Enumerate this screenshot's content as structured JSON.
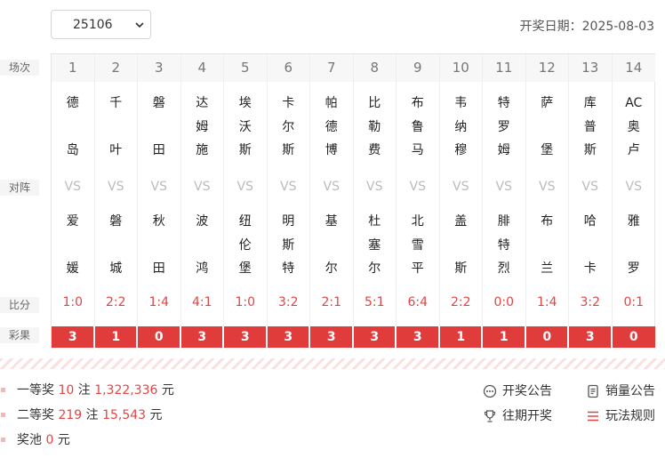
{
  "issue_select": {
    "value": "25106"
  },
  "draw_date_label": "开奖日期：2025-08-03",
  "row_labels": {
    "match": "场次",
    "versus": "对阵",
    "score": "比分",
    "result": "彩果"
  },
  "vs_text": "VS",
  "matches": [
    {
      "no": "1",
      "home": [
        "德",
        "岛"
      ],
      "away": [
        "爱",
        "媛"
      ],
      "score": "1:0",
      "result": "3"
    },
    {
      "no": "2",
      "home": [
        "千",
        "叶"
      ],
      "away": [
        "磐",
        "城"
      ],
      "score": "2:2",
      "result": "1"
    },
    {
      "no": "3",
      "home": [
        "磐",
        "田"
      ],
      "away": [
        "秋",
        "田"
      ],
      "score": "1:4",
      "result": "0"
    },
    {
      "no": "4",
      "home": [
        "达",
        "姆",
        "施"
      ],
      "away": [
        "波",
        "鸿"
      ],
      "score": "4:1",
      "result": "3"
    },
    {
      "no": "5",
      "home": [
        "埃",
        "沃",
        "斯"
      ],
      "away": [
        "纽",
        "伦",
        "堡"
      ],
      "score": "1:0",
      "result": "3"
    },
    {
      "no": "6",
      "home": [
        "卡",
        "尔",
        "斯"
      ],
      "away": [
        "明",
        "斯",
        "特"
      ],
      "score": "3:2",
      "result": "3"
    },
    {
      "no": "7",
      "home": [
        "帕",
        "德",
        "博"
      ],
      "away": [
        "基",
        "尔"
      ],
      "score": "2:1",
      "result": "3"
    },
    {
      "no": "8",
      "home": [
        "比",
        "勒",
        "费"
      ],
      "away": [
        "杜",
        "塞",
        "尔"
      ],
      "score": "5:1",
      "result": "3"
    },
    {
      "no": "9",
      "home": [
        "布",
        "鲁",
        "马"
      ],
      "away": [
        "北",
        "雪",
        "平"
      ],
      "score": "6:4",
      "result": "3"
    },
    {
      "no": "10",
      "home": [
        "韦",
        "纳",
        "穆"
      ],
      "away": [
        "盖",
        "斯"
      ],
      "score": "2:2",
      "result": "1"
    },
    {
      "no": "11",
      "home": [
        "特",
        "罗",
        "姆"
      ],
      "away": [
        "腓",
        "特",
        "烈"
      ],
      "score": "0:0",
      "result": "1"
    },
    {
      "no": "12",
      "home": [
        "萨",
        "堡"
      ],
      "away": [
        "布",
        "兰"
      ],
      "score": "1:4",
      "result": "0"
    },
    {
      "no": "13",
      "home": [
        "库",
        "普",
        "斯"
      ],
      "away": [
        "哈",
        "卡"
      ],
      "score": "3:2",
      "result": "3"
    },
    {
      "no": "14",
      "home": [
        "AC",
        "奥",
        "卢"
      ],
      "away": [
        "雅",
        "罗"
      ],
      "score": "0:1",
      "result": "0"
    }
  ],
  "prizes": [
    {
      "label": "一等奖",
      "count": "10",
      "unit": "注",
      "amount": "1,322,336",
      "currency": "元"
    },
    {
      "label": "二等奖",
      "count": "219",
      "unit": "注",
      "amount": "15,543",
      "currency": "元"
    }
  ],
  "pool": {
    "label": "奖池",
    "amount": "0",
    "currency": "元"
  },
  "links": {
    "announcement": "开奖公告",
    "sales": "销量公告",
    "history": "往期开奖",
    "rules": "玩法规则"
  },
  "colors": {
    "accent": "#e03c3c",
    "score": "#e04545",
    "vs": "#bbbbbb"
  },
  "icons": {
    "announcement": "chat-dots-icon",
    "sales": "document-icon",
    "history": "trophy-icon",
    "rules": "list-icon"
  }
}
